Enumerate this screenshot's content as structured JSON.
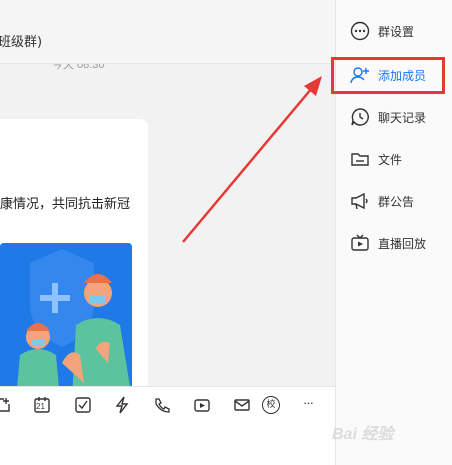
{
  "header": {
    "title": "班级群)",
    "timestamp": "今天 08:30"
  },
  "message": {
    "text": "康情况，共同抗击新冠"
  },
  "toolbar": {
    "items": [
      "attachment-icon",
      "calendar-icon",
      "checkbox-icon",
      "lightning-icon",
      "phone-icon",
      "live-icon",
      "mail-icon",
      "school-icon",
      "more-icon"
    ],
    "calendar_number": "21",
    "school_label": "校",
    "more_label": "···"
  },
  "sidebar": {
    "items": [
      {
        "label": "群设置",
        "icon": "more-circle-icon"
      },
      {
        "label": "添加成员",
        "icon": "add-user-icon",
        "active": true
      },
      {
        "label": "聊天记录",
        "icon": "chat-history-icon"
      },
      {
        "label": "文件",
        "icon": "folder-icon"
      },
      {
        "label": "群公告",
        "icon": "megaphone-icon"
      },
      {
        "label": "直播回放",
        "icon": "tv-icon"
      }
    ]
  },
  "colors": {
    "accent": "#1677ff",
    "highlight": "#e53935",
    "illustration_bg": "#1a73e8"
  },
  "watermark": {
    "text": "Bai 经验"
  }
}
